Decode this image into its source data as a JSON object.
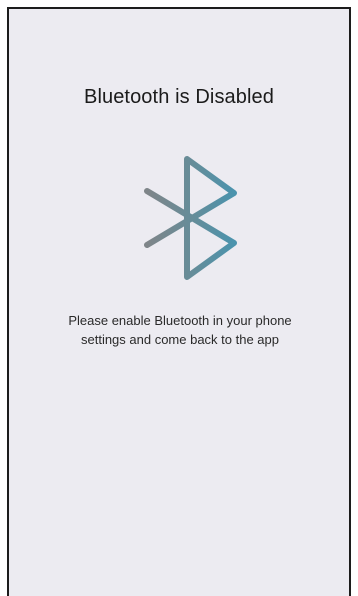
{
  "screen": {
    "title": "Bluetooth is Disabled",
    "icon": "bluetooth-icon",
    "message_line1": "Please enable Bluetooth in your phone",
    "message_line2": "settings and come back to the app"
  },
  "colors": {
    "background": "#ecebf1",
    "icon_gradient_start": "#7f8589",
    "icon_gradient_end": "#4f91a8",
    "text": "#1b1b1b"
  }
}
